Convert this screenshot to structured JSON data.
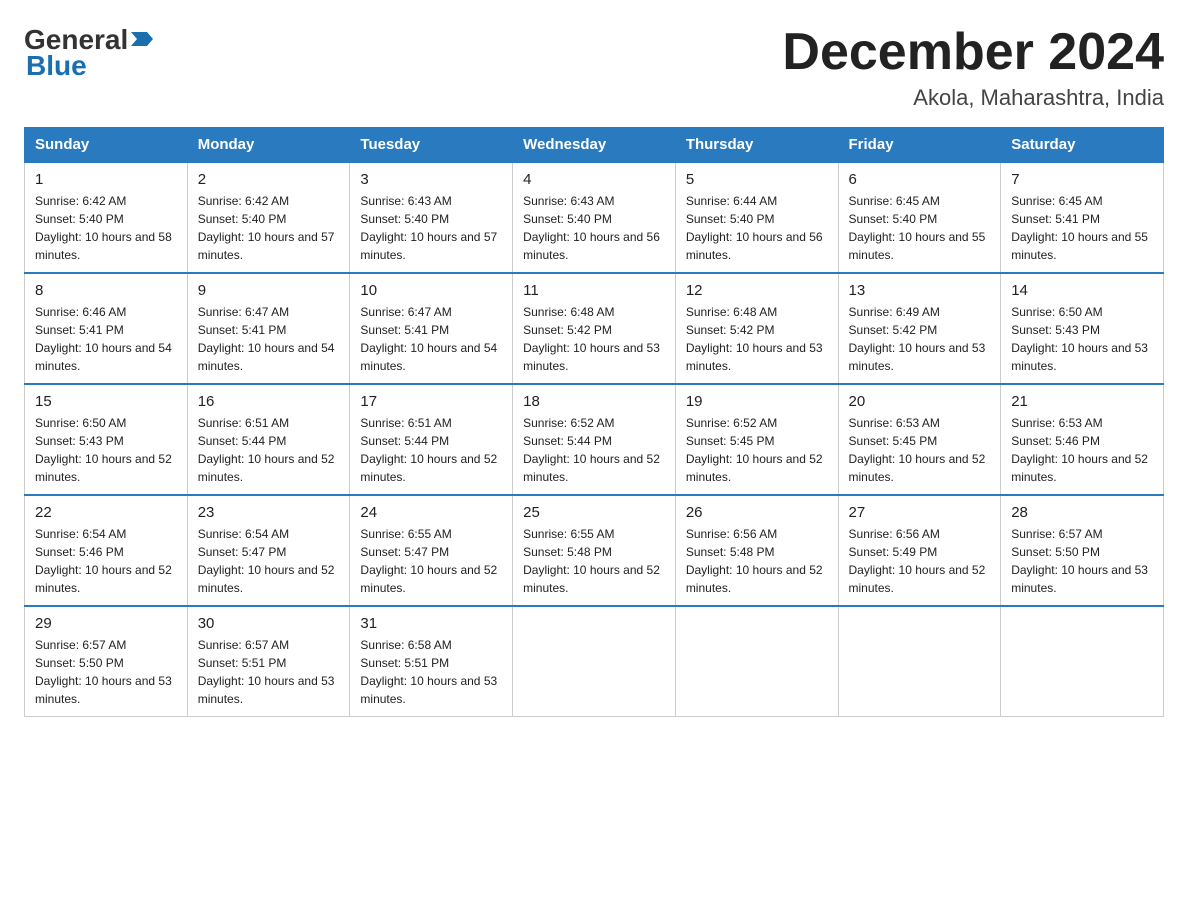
{
  "header": {
    "logo_general": "General",
    "logo_blue": "Blue",
    "month_year": "December 2024",
    "location": "Akola, Maharashtra, India"
  },
  "days_of_week": [
    "Sunday",
    "Monday",
    "Tuesday",
    "Wednesday",
    "Thursday",
    "Friday",
    "Saturday"
  ],
  "weeks": [
    [
      {
        "day": "1",
        "sunrise": "6:42 AM",
        "sunset": "5:40 PM",
        "daylight": "10 hours and 58 minutes."
      },
      {
        "day": "2",
        "sunrise": "6:42 AM",
        "sunset": "5:40 PM",
        "daylight": "10 hours and 57 minutes."
      },
      {
        "day": "3",
        "sunrise": "6:43 AM",
        "sunset": "5:40 PM",
        "daylight": "10 hours and 57 minutes."
      },
      {
        "day": "4",
        "sunrise": "6:43 AM",
        "sunset": "5:40 PM",
        "daylight": "10 hours and 56 minutes."
      },
      {
        "day": "5",
        "sunrise": "6:44 AM",
        "sunset": "5:40 PM",
        "daylight": "10 hours and 56 minutes."
      },
      {
        "day": "6",
        "sunrise": "6:45 AM",
        "sunset": "5:40 PM",
        "daylight": "10 hours and 55 minutes."
      },
      {
        "day": "7",
        "sunrise": "6:45 AM",
        "sunset": "5:41 PM",
        "daylight": "10 hours and 55 minutes."
      }
    ],
    [
      {
        "day": "8",
        "sunrise": "6:46 AM",
        "sunset": "5:41 PM",
        "daylight": "10 hours and 54 minutes."
      },
      {
        "day": "9",
        "sunrise": "6:47 AM",
        "sunset": "5:41 PM",
        "daylight": "10 hours and 54 minutes."
      },
      {
        "day": "10",
        "sunrise": "6:47 AM",
        "sunset": "5:41 PM",
        "daylight": "10 hours and 54 minutes."
      },
      {
        "day": "11",
        "sunrise": "6:48 AM",
        "sunset": "5:42 PM",
        "daylight": "10 hours and 53 minutes."
      },
      {
        "day": "12",
        "sunrise": "6:48 AM",
        "sunset": "5:42 PM",
        "daylight": "10 hours and 53 minutes."
      },
      {
        "day": "13",
        "sunrise": "6:49 AM",
        "sunset": "5:42 PM",
        "daylight": "10 hours and 53 minutes."
      },
      {
        "day": "14",
        "sunrise": "6:50 AM",
        "sunset": "5:43 PM",
        "daylight": "10 hours and 53 minutes."
      }
    ],
    [
      {
        "day": "15",
        "sunrise": "6:50 AM",
        "sunset": "5:43 PM",
        "daylight": "10 hours and 52 minutes."
      },
      {
        "day": "16",
        "sunrise": "6:51 AM",
        "sunset": "5:44 PM",
        "daylight": "10 hours and 52 minutes."
      },
      {
        "day": "17",
        "sunrise": "6:51 AM",
        "sunset": "5:44 PM",
        "daylight": "10 hours and 52 minutes."
      },
      {
        "day": "18",
        "sunrise": "6:52 AM",
        "sunset": "5:44 PM",
        "daylight": "10 hours and 52 minutes."
      },
      {
        "day": "19",
        "sunrise": "6:52 AM",
        "sunset": "5:45 PM",
        "daylight": "10 hours and 52 minutes."
      },
      {
        "day": "20",
        "sunrise": "6:53 AM",
        "sunset": "5:45 PM",
        "daylight": "10 hours and 52 minutes."
      },
      {
        "day": "21",
        "sunrise": "6:53 AM",
        "sunset": "5:46 PM",
        "daylight": "10 hours and 52 minutes."
      }
    ],
    [
      {
        "day": "22",
        "sunrise": "6:54 AM",
        "sunset": "5:46 PM",
        "daylight": "10 hours and 52 minutes."
      },
      {
        "day": "23",
        "sunrise": "6:54 AM",
        "sunset": "5:47 PM",
        "daylight": "10 hours and 52 minutes."
      },
      {
        "day": "24",
        "sunrise": "6:55 AM",
        "sunset": "5:47 PM",
        "daylight": "10 hours and 52 minutes."
      },
      {
        "day": "25",
        "sunrise": "6:55 AM",
        "sunset": "5:48 PM",
        "daylight": "10 hours and 52 minutes."
      },
      {
        "day": "26",
        "sunrise": "6:56 AM",
        "sunset": "5:48 PM",
        "daylight": "10 hours and 52 minutes."
      },
      {
        "day": "27",
        "sunrise": "6:56 AM",
        "sunset": "5:49 PM",
        "daylight": "10 hours and 52 minutes."
      },
      {
        "day": "28",
        "sunrise": "6:57 AM",
        "sunset": "5:50 PM",
        "daylight": "10 hours and 53 minutes."
      }
    ],
    [
      {
        "day": "29",
        "sunrise": "6:57 AM",
        "sunset": "5:50 PM",
        "daylight": "10 hours and 53 minutes."
      },
      {
        "day": "30",
        "sunrise": "6:57 AM",
        "sunset": "5:51 PM",
        "daylight": "10 hours and 53 minutes."
      },
      {
        "day": "31",
        "sunrise": "6:58 AM",
        "sunset": "5:51 PM",
        "daylight": "10 hours and 53 minutes."
      },
      null,
      null,
      null,
      null
    ]
  ]
}
